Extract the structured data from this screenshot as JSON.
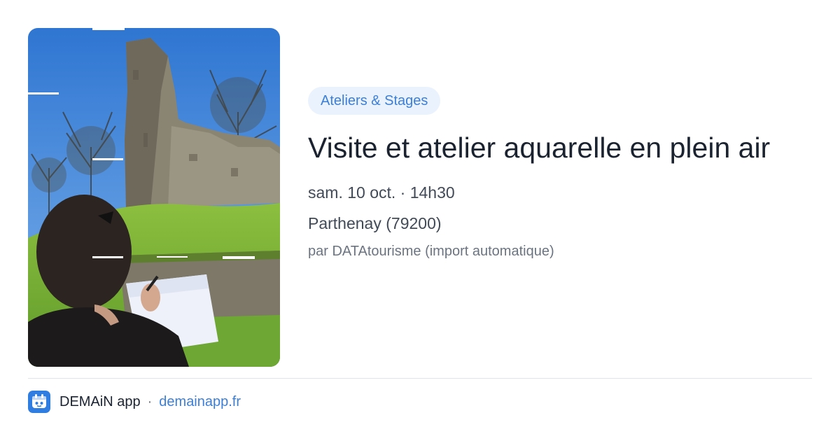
{
  "event": {
    "category": "Ateliers & Stages",
    "title": "Visite et atelier aquarelle en plein air",
    "date": "sam. 10 oct. · 14h30",
    "location": "Parthenay (79200)",
    "source": "par DATAtourisme (import automatique)",
    "image_icon": "event-photo"
  },
  "footer": {
    "app_name": "DEMAiN app",
    "separator": "·",
    "link": "demainapp.fr",
    "logo_icon": "demain-logo-icon"
  },
  "colors": {
    "accent": "#3d7fd6",
    "pill_background": "#eaf2fd",
    "title": "#1b2330",
    "meta": "#414a56",
    "muted": "#6b7480",
    "logo": "#2f7de0"
  }
}
